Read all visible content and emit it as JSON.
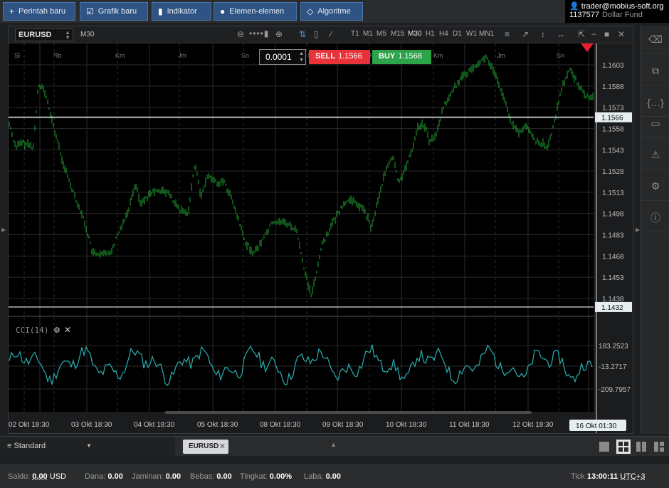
{
  "toolbar": {
    "new_order": "Perintah baru",
    "new_chart": "Grafik baru",
    "indicator": "Indikator",
    "elements": "Elemen-elemen",
    "algorithm": "Algoritme"
  },
  "account": {
    "email": "trader@mobius-soft.org",
    "number": "1137577",
    "fund_name": "Dollar Fund"
  },
  "chart": {
    "symbol": "EURUSD",
    "timeframe_label": "M30",
    "timeframes": [
      "T1",
      "M1",
      "M5",
      "M15",
      "M30",
      "H1",
      "H4",
      "D1",
      "W1",
      "MN1"
    ],
    "active_timeframe": "M30",
    "quantity": "0.0001",
    "sell_label": "SELL",
    "sell_price": "1.1566",
    "buy_label": "BUY",
    "buy_price": "1.1568",
    "current_price_label": "1.1566",
    "low_line_label": "1.1432",
    "price_ticks": [
      "1.1603",
      "1.1588",
      "1.1573",
      "1.1558",
      "1.1543",
      "1.1528",
      "1.1513",
      "1.1498",
      "1.1483",
      "1.1468",
      "1.1453",
      "1.1438"
    ],
    "day_labels": [
      "Sl",
      "Rb",
      "Km",
      "Jm",
      "Sn",
      "Sl",
      "Rb",
      "Km",
      "Jm",
      "Sn"
    ],
    "date_labels": [
      "02 Okt 18:30",
      "03 Okt 18:30",
      "04 Okt 18:30",
      "05 Okt 18:30",
      "08 Okt 18:30",
      "09 Okt 18:30",
      "10 Okt 18:30",
      "11 Okt 18:30",
      "12 Okt 18:30"
    ],
    "cursor_date": "16 Okt 01:30",
    "bar_color": "#1fa834",
    "hline_color": "#e6f0ee",
    "marker_color": "#e8202a"
  },
  "indicator": {
    "label": "CCI(14)",
    "ticks": [
      "183.2523",
      "-13.2717",
      "-209.7957"
    ],
    "line_color": "#2ab0b0"
  },
  "tabs": {
    "profile": "Standard",
    "active_tab": "EURUSD"
  },
  "status": {
    "saldo_label": "Saldo:",
    "saldo_value": "0.00",
    "saldo_currency": "USD",
    "dana_label": "Dana:",
    "dana_value": "0.00",
    "jaminan_label": "Jaminan:",
    "jaminan_value": "0.00",
    "bebas_label": "Bebas:",
    "bebas_value": "0.00",
    "tingkat_label": "Tingkat:",
    "tingkat_value": "0.00%",
    "laba_label": "Laba:",
    "laba_value": "0.00",
    "tick_label": "Tick",
    "time": "13:00:11",
    "timezone": "UTC+3"
  }
}
